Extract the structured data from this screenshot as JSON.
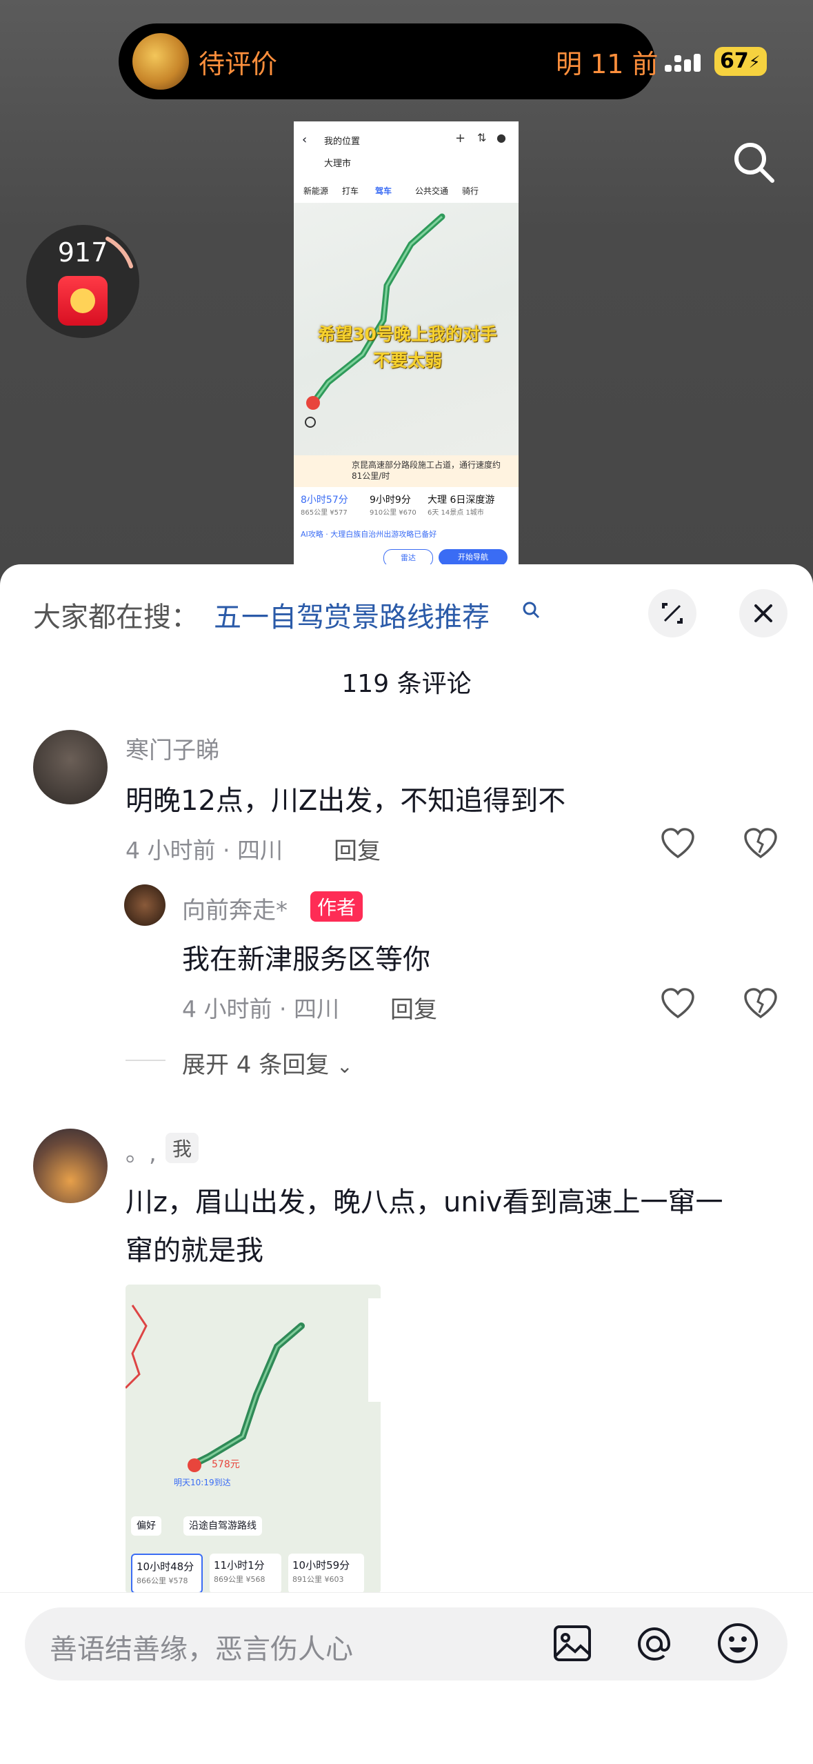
{
  "status": {
    "left_text": "待评价",
    "right_text": "明 11 前",
    "battery": "67"
  },
  "video": {
    "from": "我的位置",
    "to": "大理市",
    "tabs": [
      "新能源",
      "打车",
      "驾车",
      "公共交通",
      "骑行"
    ],
    "caption_line1": "希望30号晚上我的对手",
    "caption_line2": "不要太弱",
    "notice": "京昆高速部分路段施工占道，通行速度约81公里/时",
    "routes": [
      {
        "time": "8小时57分",
        "sub": "865公里 ¥577"
      },
      {
        "time": "9小时9分",
        "sub": "910公里 ¥670"
      },
      {
        "time": "大理 6日深度游",
        "sub": "6天 14景点 1城市"
      }
    ],
    "ai": "AI攻略 · 大理白族自治州出游攻略已备好",
    "btn_radar": "雷达",
    "btn_nav": "开始导航"
  },
  "redpack": {
    "count": "917"
  },
  "comments_panel": {
    "hot_label": "大家都在搜：",
    "hot_link": "五一自驾赏景路线推荐",
    "count_text": "119 条评论",
    "comments": [
      {
        "name": "寒门子睇",
        "text": "明晚12点，川Z出发，不知追得到不",
        "meta": "4 小时前 · 四川",
        "reply_label": "回复"
      },
      {
        "name": "向前奔走*",
        "tag": "作者",
        "text": "我在新津服务区等你",
        "meta": "4 小时前 · 四川",
        "reply_label": "回复"
      },
      {
        "expand": "展开 4 条回复"
      },
      {
        "name": "。,",
        "tag": "我",
        "text_line1": "川z，眉山出发，晚八点，univ看到高速上一窜一",
        "text_line2": "窜的就是我",
        "image_routes": [
          {
            "time": "10小时48分",
            "sub": "866公里 ¥578"
          },
          {
            "time": "11小时1分",
            "sub": "869公里 ¥568"
          },
          {
            "time": "10小时59分",
            "sub": "891公里 ¥603"
          }
        ],
        "image_chip1": "偏好",
        "image_chip2": "沿途自驾游路线",
        "image_price": "578元",
        "image_arrive": "明天10:19到达"
      }
    ]
  },
  "input": {
    "placeholder": "善语结善缘，恶言伤人心"
  }
}
